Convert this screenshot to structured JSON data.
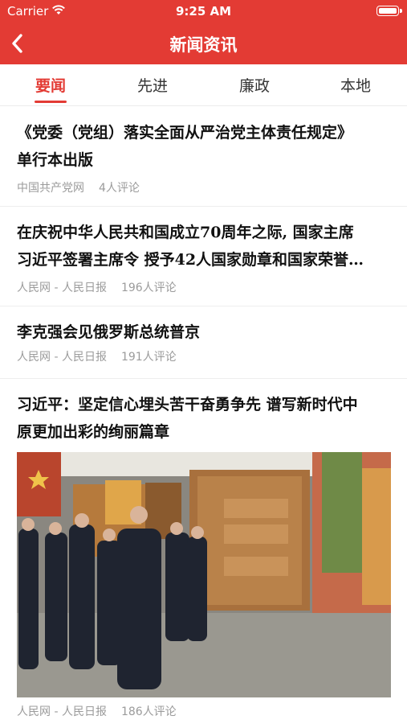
{
  "status_bar": {
    "carrier": "Carrier",
    "time": "9:25 AM"
  },
  "header": {
    "title": "新闻资讯",
    "back_icon": "chevron-left-icon"
  },
  "tabs": [
    {
      "label": "要闻",
      "active": true
    },
    {
      "label": "先进",
      "active": false
    },
    {
      "label": "廉政",
      "active": false
    },
    {
      "label": "本地",
      "active": false
    }
  ],
  "news": [
    {
      "title_lines": [
        "《党委（党组）落实全面从严治党主体责任规定》",
        "单行本出版"
      ],
      "source": "中国共产党网",
      "comments": "4人评论"
    },
    {
      "title_lines": [
        "在庆祝中华人民共和国成立70周年之际, 国家主席",
        "习近平签署主席令 授予42人国家勋章和国家荣誉…"
      ],
      "source": "人民网 - 人民日报",
      "comments": "196人评论"
    },
    {
      "title_lines": [
        "李克强会见俄罗斯总统普京"
      ],
      "source": "人民网 - 人民日报",
      "comments": "191人评论"
    },
    {
      "title_lines": [
        "习近平：坚定信心埋头苦干奋勇争先 谱写新时代中",
        "原更加出彩的绚丽篇章"
      ],
      "source": "人民网 - 人民日报",
      "comments": "186人评论",
      "has_image": true
    }
  ],
  "colors": {
    "brand_red": "#e33b34",
    "meta_gray": "#9b9b9b"
  }
}
